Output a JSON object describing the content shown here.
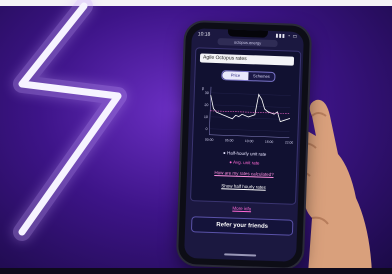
{
  "photo": {
    "subject": "hand holding smartphone",
    "neon_sign_color": "#f6f3ff",
    "background_color": "#4a1aa0"
  },
  "phone": {
    "status_time": "10:18",
    "status_icons": "signal-wifi-battery",
    "url": "octopus.energy",
    "select_value": "Agile Octopus rates",
    "toggle": {
      "left": "Price",
      "right": "Schemes"
    },
    "legend_primary": "Half-hourly unit rate",
    "legend_secondary": "Avg. unit rate",
    "link_rates": "How are my rates calculated?",
    "link_show_rates": "Show half hourly rates",
    "link_more": "More info",
    "refer_button": "Refer your friends"
  },
  "chart_data": {
    "type": "line",
    "title": "",
    "xlabel": "",
    "ylabel": "p",
    "x_ticks": [
      "00:00",
      "05:00",
      "10:00",
      "16:00",
      "22:00"
    ],
    "y_ticks": [
      "30",
      "20",
      "10",
      "0"
    ],
    "ylim": [
      -5,
      35
    ],
    "series": [
      {
        "name": "Half-hourly unit rate",
        "color": "#ffffff",
        "values": [
          28,
          17,
          14,
          13,
          12,
          11,
          10,
          9,
          12,
          11,
          13,
          12,
          11,
          12,
          13,
          30,
          26,
          18,
          16,
          15,
          14,
          16,
          8,
          9,
          10,
          11
        ]
      },
      {
        "name": "Avg. unit rate",
        "color": "#ff6ad5",
        "values": [
          15,
          15,
          15,
          15,
          15,
          15,
          15,
          15,
          15,
          15,
          15,
          15,
          15,
          15,
          15,
          15,
          15,
          15,
          15,
          15,
          15,
          15,
          15,
          15,
          15,
          15
        ]
      }
    ]
  }
}
